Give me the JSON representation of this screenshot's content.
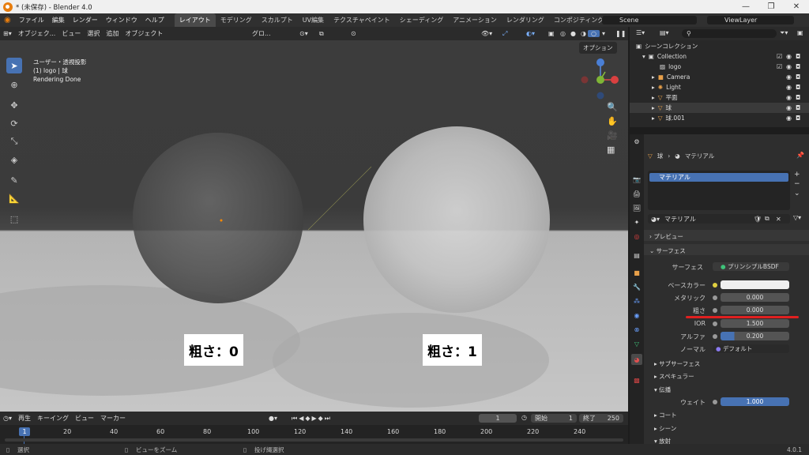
{
  "window": {
    "title": "* (未保存) - Blender 4.0",
    "min": "—",
    "max": "❐",
    "close": "✕"
  },
  "menus": [
    "ファイル",
    "編集",
    "レンダー",
    "ウィンドウ",
    "ヘルプ"
  ],
  "workspaces": [
    "レイアウト",
    "モデリング",
    "スカルプト",
    "UV編集",
    "テクスチャペイント",
    "シェーディング",
    "アニメーション",
    "レンダリング",
    "コンポジティング"
  ],
  "scene": "Scene",
  "viewlayer": "ViewLayer",
  "vp_header": {
    "mode": "オブジェク...",
    "view": "ビュー",
    "select": "選択",
    "add": "追加",
    "object": "オブジェクト",
    "orientation": "グロ...",
    "options": "オプション"
  },
  "overlay": {
    "line1": "ユーザー・透視投影",
    "line2": "(1) logo | 球",
    "line3": "Rendering Done"
  },
  "labels": {
    "left": "粗さ：0",
    "right": "粗さ：1"
  },
  "timeline": {
    "playback": "再生",
    "keying": "キーイング",
    "view": "ビュー",
    "marker": "マーカー",
    "frame": "1",
    "start_label": "開始",
    "start": "1",
    "end_label": "終了",
    "end": "250",
    "ticks": [
      "1",
      "20",
      "40",
      "60",
      "80",
      "100",
      "120",
      "140",
      "160",
      "180",
      "200",
      "220",
      "240"
    ]
  },
  "status": {
    "select": "選択",
    "zoom": "ビューをズーム",
    "lasso": "投げ縄選択",
    "version": "4.0.1"
  },
  "outliner": {
    "root": "シーンコレクション",
    "items": [
      {
        "name": "Collection",
        "indent": 1
      },
      {
        "name": "logo",
        "indent": 2
      },
      {
        "name": "Camera",
        "indent": 2
      },
      {
        "name": "Light",
        "indent": 2
      },
      {
        "name": "平面",
        "indent": 2
      },
      {
        "name": "球",
        "indent": 2
      },
      {
        "name": "球.001",
        "indent": 2
      }
    ]
  },
  "props": {
    "breadcrumb_obj": "球",
    "breadcrumb_mat": "マテリアル",
    "slot": "マテリアル",
    "material_name": "マテリアル",
    "preview": "プレビュー",
    "surface": "サーフェス",
    "surface_label": "サーフェス",
    "surface_value": "プリンシプルBSDF",
    "fields": [
      {
        "label": "ベースカラー",
        "value": ""
      },
      {
        "label": "メタリック",
        "value": "0.000"
      },
      {
        "label": "粗さ",
        "value": "0.000"
      },
      {
        "label": "IOR",
        "value": "1.500"
      },
      {
        "label": "アルファ",
        "value": "0.200"
      },
      {
        "label": "ノーマル",
        "value": "デフォルト"
      }
    ],
    "subsurface": "サブサーフェス",
    "specular": "スペキュラー",
    "transmission": "伝播",
    "weight_label": "ウェイト",
    "weight": "1.000",
    "coat": "コート",
    "sheen": "シーン",
    "emission": "放射"
  },
  "colors": {
    "accent": "#4772b3",
    "red_underline": "#e02020"
  }
}
